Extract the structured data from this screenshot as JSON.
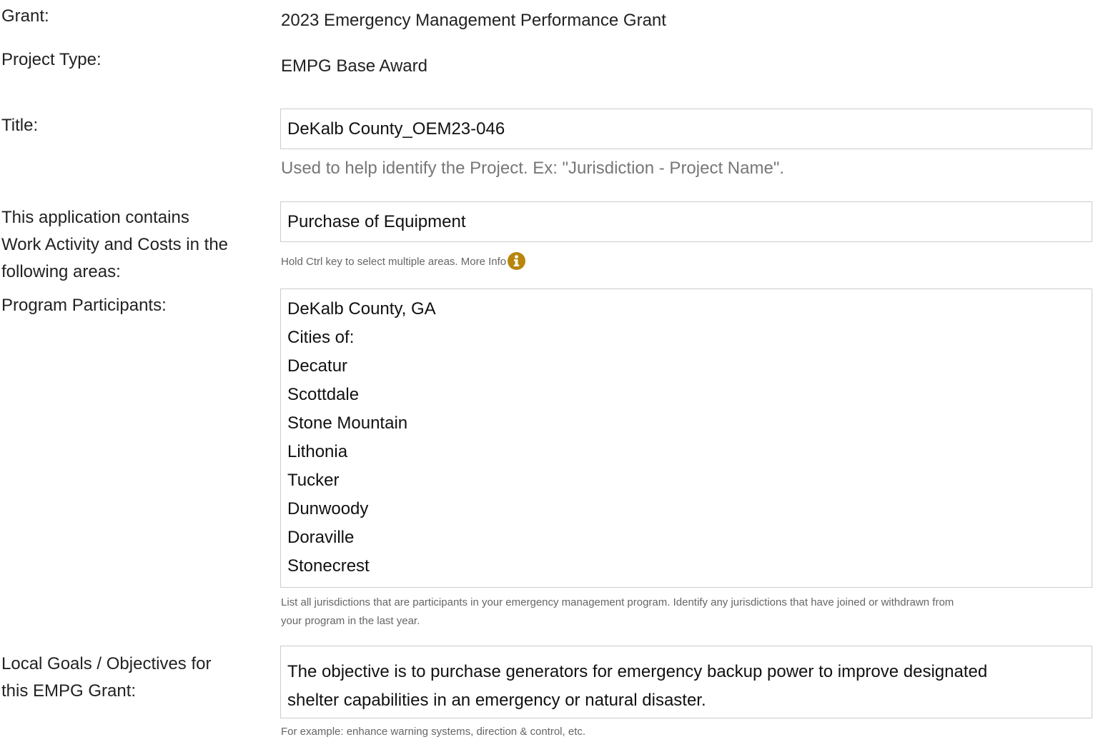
{
  "grant": {
    "label": "Grant:",
    "value": "2023 Emergency Management Performance Grant"
  },
  "project_type": {
    "label": "Project Type:",
    "value": "EMPG Base Award"
  },
  "title": {
    "label": "Title:",
    "value": "DeKalb County_OEM23-046",
    "help": "Used to help identify the Project. Ex: \"Jurisdiction - Project Name\"."
  },
  "work_areas": {
    "label_lines": [
      "This application contains",
      "Work Activity and Costs in the",
      "following areas:"
    ],
    "selected": "Purchase of Equipment",
    "help": "Hold Ctrl key to select multiple areas. More Info",
    "info_icon": "info-circle-icon",
    "info_icon_color": "#b8860b"
  },
  "participants": {
    "label": "Program Participants:",
    "lines": [
      "DeKalb County, GA",
      "Cities of:",
      "Decatur",
      "Scottdale",
      "Stone Mountain",
      "Lithonia",
      "Tucker",
      "Dunwoody",
      "Doraville",
      "Stonecrest"
    ],
    "help_lines": [
      "List all jurisdictions that are participants in your emergency management program. Identify any jurisdictions that have joined or withdrawn from",
      "your program in the last year."
    ]
  },
  "goals": {
    "label_lines": [
      "Local Goals / Objectives for",
      "this EMPG Grant:"
    ],
    "value_lines": [
      "The objective is to purchase generators for emergency backup power to improve designated",
      "shelter capabilities in an emergency or natural disaster."
    ],
    "help": "For example: enhance warning systems, direction & control, etc."
  }
}
